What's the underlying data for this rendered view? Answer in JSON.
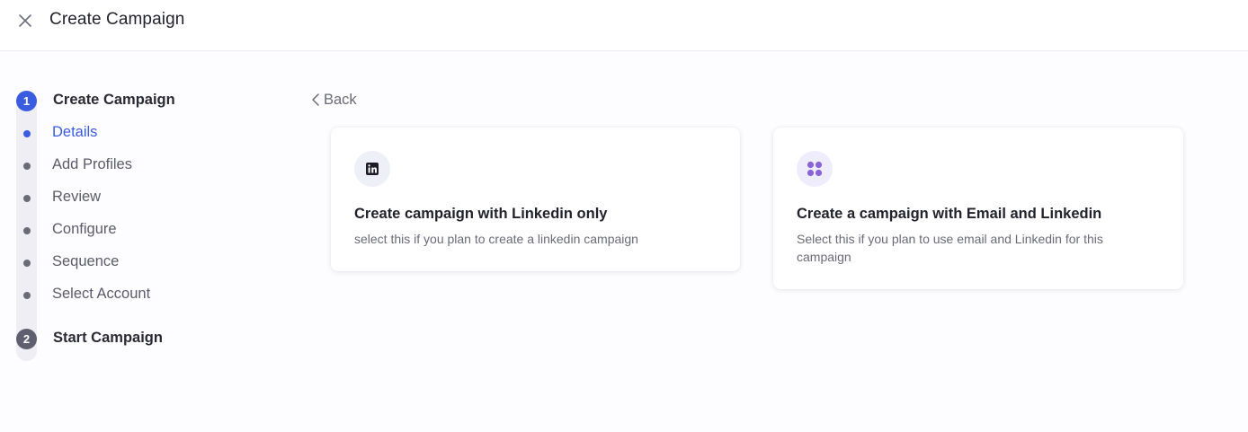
{
  "header": {
    "title": "Create Campaign",
    "close_icon": "close-icon"
  },
  "stepper": {
    "steps": [
      {
        "number": "1",
        "title": "Create Campaign",
        "state": "active",
        "substeps": [
          {
            "label": "Details",
            "current": true
          },
          {
            "label": "Add Profiles",
            "current": false
          },
          {
            "label": "Review",
            "current": false
          },
          {
            "label": "Configure",
            "current": false
          },
          {
            "label": "Sequence",
            "current": false
          },
          {
            "label": "Select Account",
            "current": false
          }
        ]
      },
      {
        "number": "2",
        "title": "Start Campaign",
        "state": "inactive"
      }
    ]
  },
  "back": {
    "label": "Back",
    "icon": "chevron-left-icon"
  },
  "options": [
    {
      "icon": "linkedin-icon",
      "title": "Create campaign with Linkedin only",
      "description": "select this if you plan to create a linkedin campaign"
    },
    {
      "icon": "apps-grid-icon",
      "title": "Create a campaign with Email and Linkedin",
      "description": "Select this if you plan to use email and Linkedin for this campaign"
    }
  ],
  "colors": {
    "accent": "#3a5ce0",
    "inactive_step": "#5f5f6f",
    "grid_icon": "#8a63d9"
  }
}
